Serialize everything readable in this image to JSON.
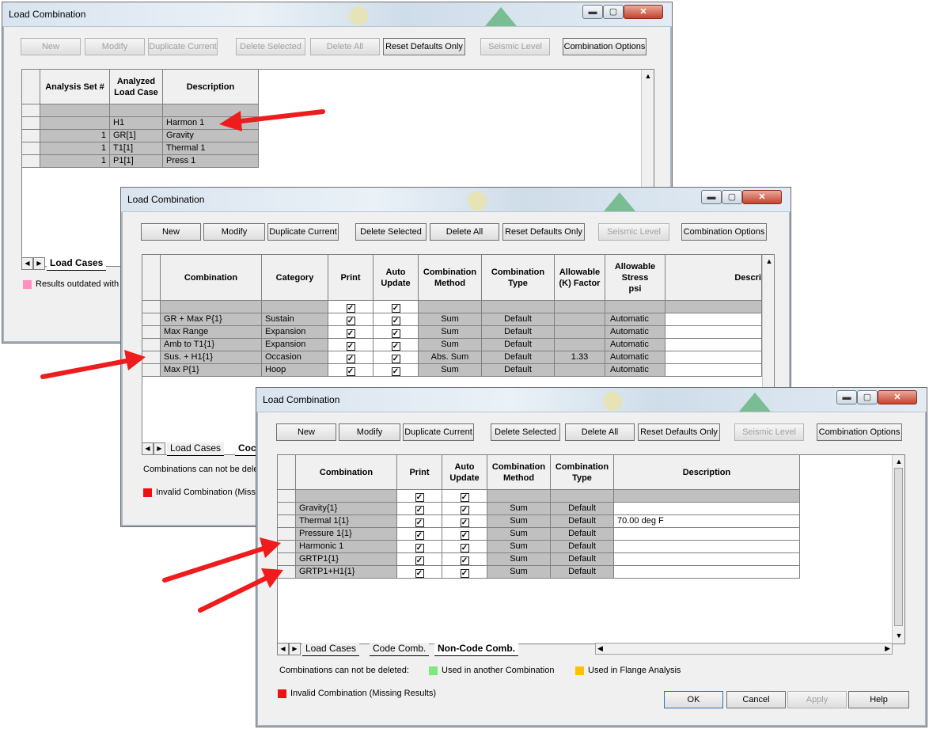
{
  "window_title": "Load Combination",
  "titlebar_buttons": {
    "minimize": "▬",
    "maximize": "▢",
    "close": "✕"
  },
  "toolbar": {
    "new": "New",
    "modify": "Modify",
    "duplicate": "Duplicate Current",
    "delete_selected": "Delete Selected",
    "delete_all": "Delete All",
    "reset_defaults": "Reset Defaults Only",
    "seismic": "Seismic Level",
    "options": "Combination Options"
  },
  "win1": {
    "headers": {
      "analysis_set": "Analysis Set #",
      "analyzed_case": "Analyzed\nLoad Case",
      "description": "Description"
    },
    "rows": [
      {
        "set": "",
        "case": "H1",
        "desc": "Harmon 1"
      },
      {
        "set": "1",
        "case": "GR[1]",
        "desc": "Gravity"
      },
      {
        "set": "1",
        "case": "T1[1]",
        "desc": "Thermal 1"
      },
      {
        "set": "1",
        "case": "P1[1]",
        "desc": "Press 1"
      }
    ],
    "tab_label": "Load Cases",
    "legend_text": "Results outdated with",
    "legend_color": "#ff8fc0"
  },
  "win2": {
    "headers": {
      "combination": "Combination",
      "category": "Category",
      "print": "Print",
      "auto_update": "Auto\nUpdate",
      "method": "Combination\nMethod",
      "type": "Combination\nType",
      "k_factor": "Allowable\n(K) Factor",
      "stress": "Allowable\nStress\npsi",
      "description": "Descri"
    },
    "rows": [
      {
        "comb": "GR + Max P{1}",
        "cat": "Sustain",
        "method": "Sum",
        "type": "Default",
        "k": "",
        "stress": "Automatic"
      },
      {
        "comb": "Max Range",
        "cat": "Expansion",
        "method": "Sum",
        "type": "Default",
        "k": "",
        "stress": "Automatic"
      },
      {
        "comb": "Amb to T1{1}",
        "cat": "Expansion",
        "method": "Sum",
        "type": "Default",
        "k": "",
        "stress": "Automatic"
      },
      {
        "comb": "Sus. + H1{1}",
        "cat": "Occasion",
        "method": "Abs. Sum",
        "type": "Default",
        "k": "1.33",
        "stress": "Automatic"
      },
      {
        "comb": "Max P{1}",
        "cat": "Hoop",
        "method": "Sum",
        "type": "Default",
        "k": "",
        "stress": "Automatic"
      }
    ],
    "tab_label": "Load Cases",
    "tab2_partial": "Coc",
    "note": "Combinations can not be dele",
    "legend_text": "Invalid Combination (Missin",
    "legend_color": "#ee1111"
  },
  "win3": {
    "headers": {
      "combination": "Combination",
      "print": "Print",
      "auto_update": "Auto\nUpdate",
      "method": "Combination\nMethod",
      "type": "Combination\nType",
      "description": "Description"
    },
    "rows": [
      {
        "comb": "Gravity{1}",
        "method": "Sum",
        "type": "Default",
        "desc": ""
      },
      {
        "comb": "Thermal 1{1}",
        "method": "Sum",
        "type": "Default",
        "desc": "70.00 deg F"
      },
      {
        "comb": "Pressure 1{1}",
        "method": "Sum",
        "type": "Default",
        "desc": ""
      },
      {
        "comb": "Harmonic 1",
        "method": "Sum",
        "type": "Default",
        "desc": ""
      },
      {
        "comb": "GRTP1{1}",
        "method": "Sum",
        "type": "Default",
        "desc": ""
      },
      {
        "comb": "GRTP1+H1{1}",
        "method": "Sum",
        "type": "Default",
        "desc": ""
      }
    ],
    "tabs": [
      "Load Cases",
      "Code Comb.",
      "Non-Code Comb."
    ],
    "note": "Combinations can not be deleted:",
    "legend_used_text": "Used in another Combination",
    "legend_used_color": "#7ee87e",
    "legend_flange_text": "Used in Flange Analysis",
    "legend_flange_color": "#ffc000",
    "legend_invalid_text": "Invalid Combination (Missing Results)",
    "legend_invalid_color": "#ee1111",
    "buttons": {
      "ok": "OK",
      "cancel": "Cancel",
      "apply": "Apply",
      "help": "Help"
    }
  },
  "check_mark": "✓",
  "arrow_color": "#ee1c1c"
}
